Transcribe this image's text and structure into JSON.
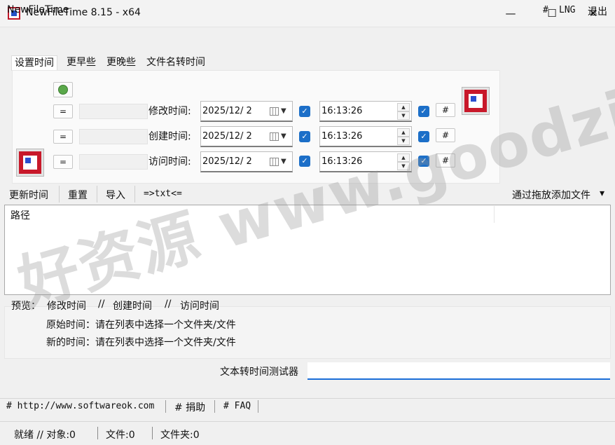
{
  "window": {
    "title": "NewFileTime 8.15 - x64",
    "minimize": "—",
    "maximize": "☐",
    "close": "✕"
  },
  "menu": {
    "app_name": "NewFileTime",
    "hash": "#",
    "lng": "LNG",
    "exit": "退出"
  },
  "tabs": [
    "设置时间",
    "更早些",
    "更晚些",
    "文件名转时间"
  ],
  "time_rows": [
    {
      "eq": "=",
      "label": "修改时间:",
      "date": "2025/12/ 2",
      "time": "16:13:26",
      "hash": "#",
      "checked": true
    },
    {
      "eq": "=",
      "label": "创建时间:",
      "date": "2025/12/ 2",
      "time": "16:13:26",
      "hash": "#",
      "checked": true
    },
    {
      "eq": "=",
      "label": "访问时间:",
      "date": "2025/12/ 2",
      "time": "16:13:26",
      "hash": "#",
      "checked": true
    }
  ],
  "icons": {
    "app": "app-icon",
    "refresh": "green-refresh-icon",
    "logo": "newfiletime-logo-icon"
  },
  "toolbar": {
    "update_time": "更新时间",
    "reset": "重置",
    "import": "导入",
    "txt": "=>txt<=",
    "drag_drop": "通过拖放添加文件",
    "drag_arrow": "▾"
  },
  "list": {
    "column_path": "路径"
  },
  "preview": {
    "label": "预览：",
    "modify": "修改时间",
    "sep1": "//",
    "create": "创建时间",
    "sep2": "//",
    "access": "访问时间",
    "original": "原始时间：请在列表中选择一个文件夹/文件",
    "new": "新的时间：请在列表中选择一个文件夹/文件"
  },
  "tester": {
    "label": "文本转时间测试器",
    "value": ""
  },
  "links": {
    "website": "# http://www.softwareok.com",
    "donate": "# 捐助",
    "faq": "# FAQ"
  },
  "status": {
    "ready": "就绪 // 对象:0",
    "files": "文件:0",
    "folders": "文件夹:0"
  },
  "watermark": "好资源 www.goodziyuan.com",
  "colors": {
    "accent": "#1c6fc8",
    "icon_red": "#c8182a",
    "icon_blue": "#2a4fcf"
  }
}
